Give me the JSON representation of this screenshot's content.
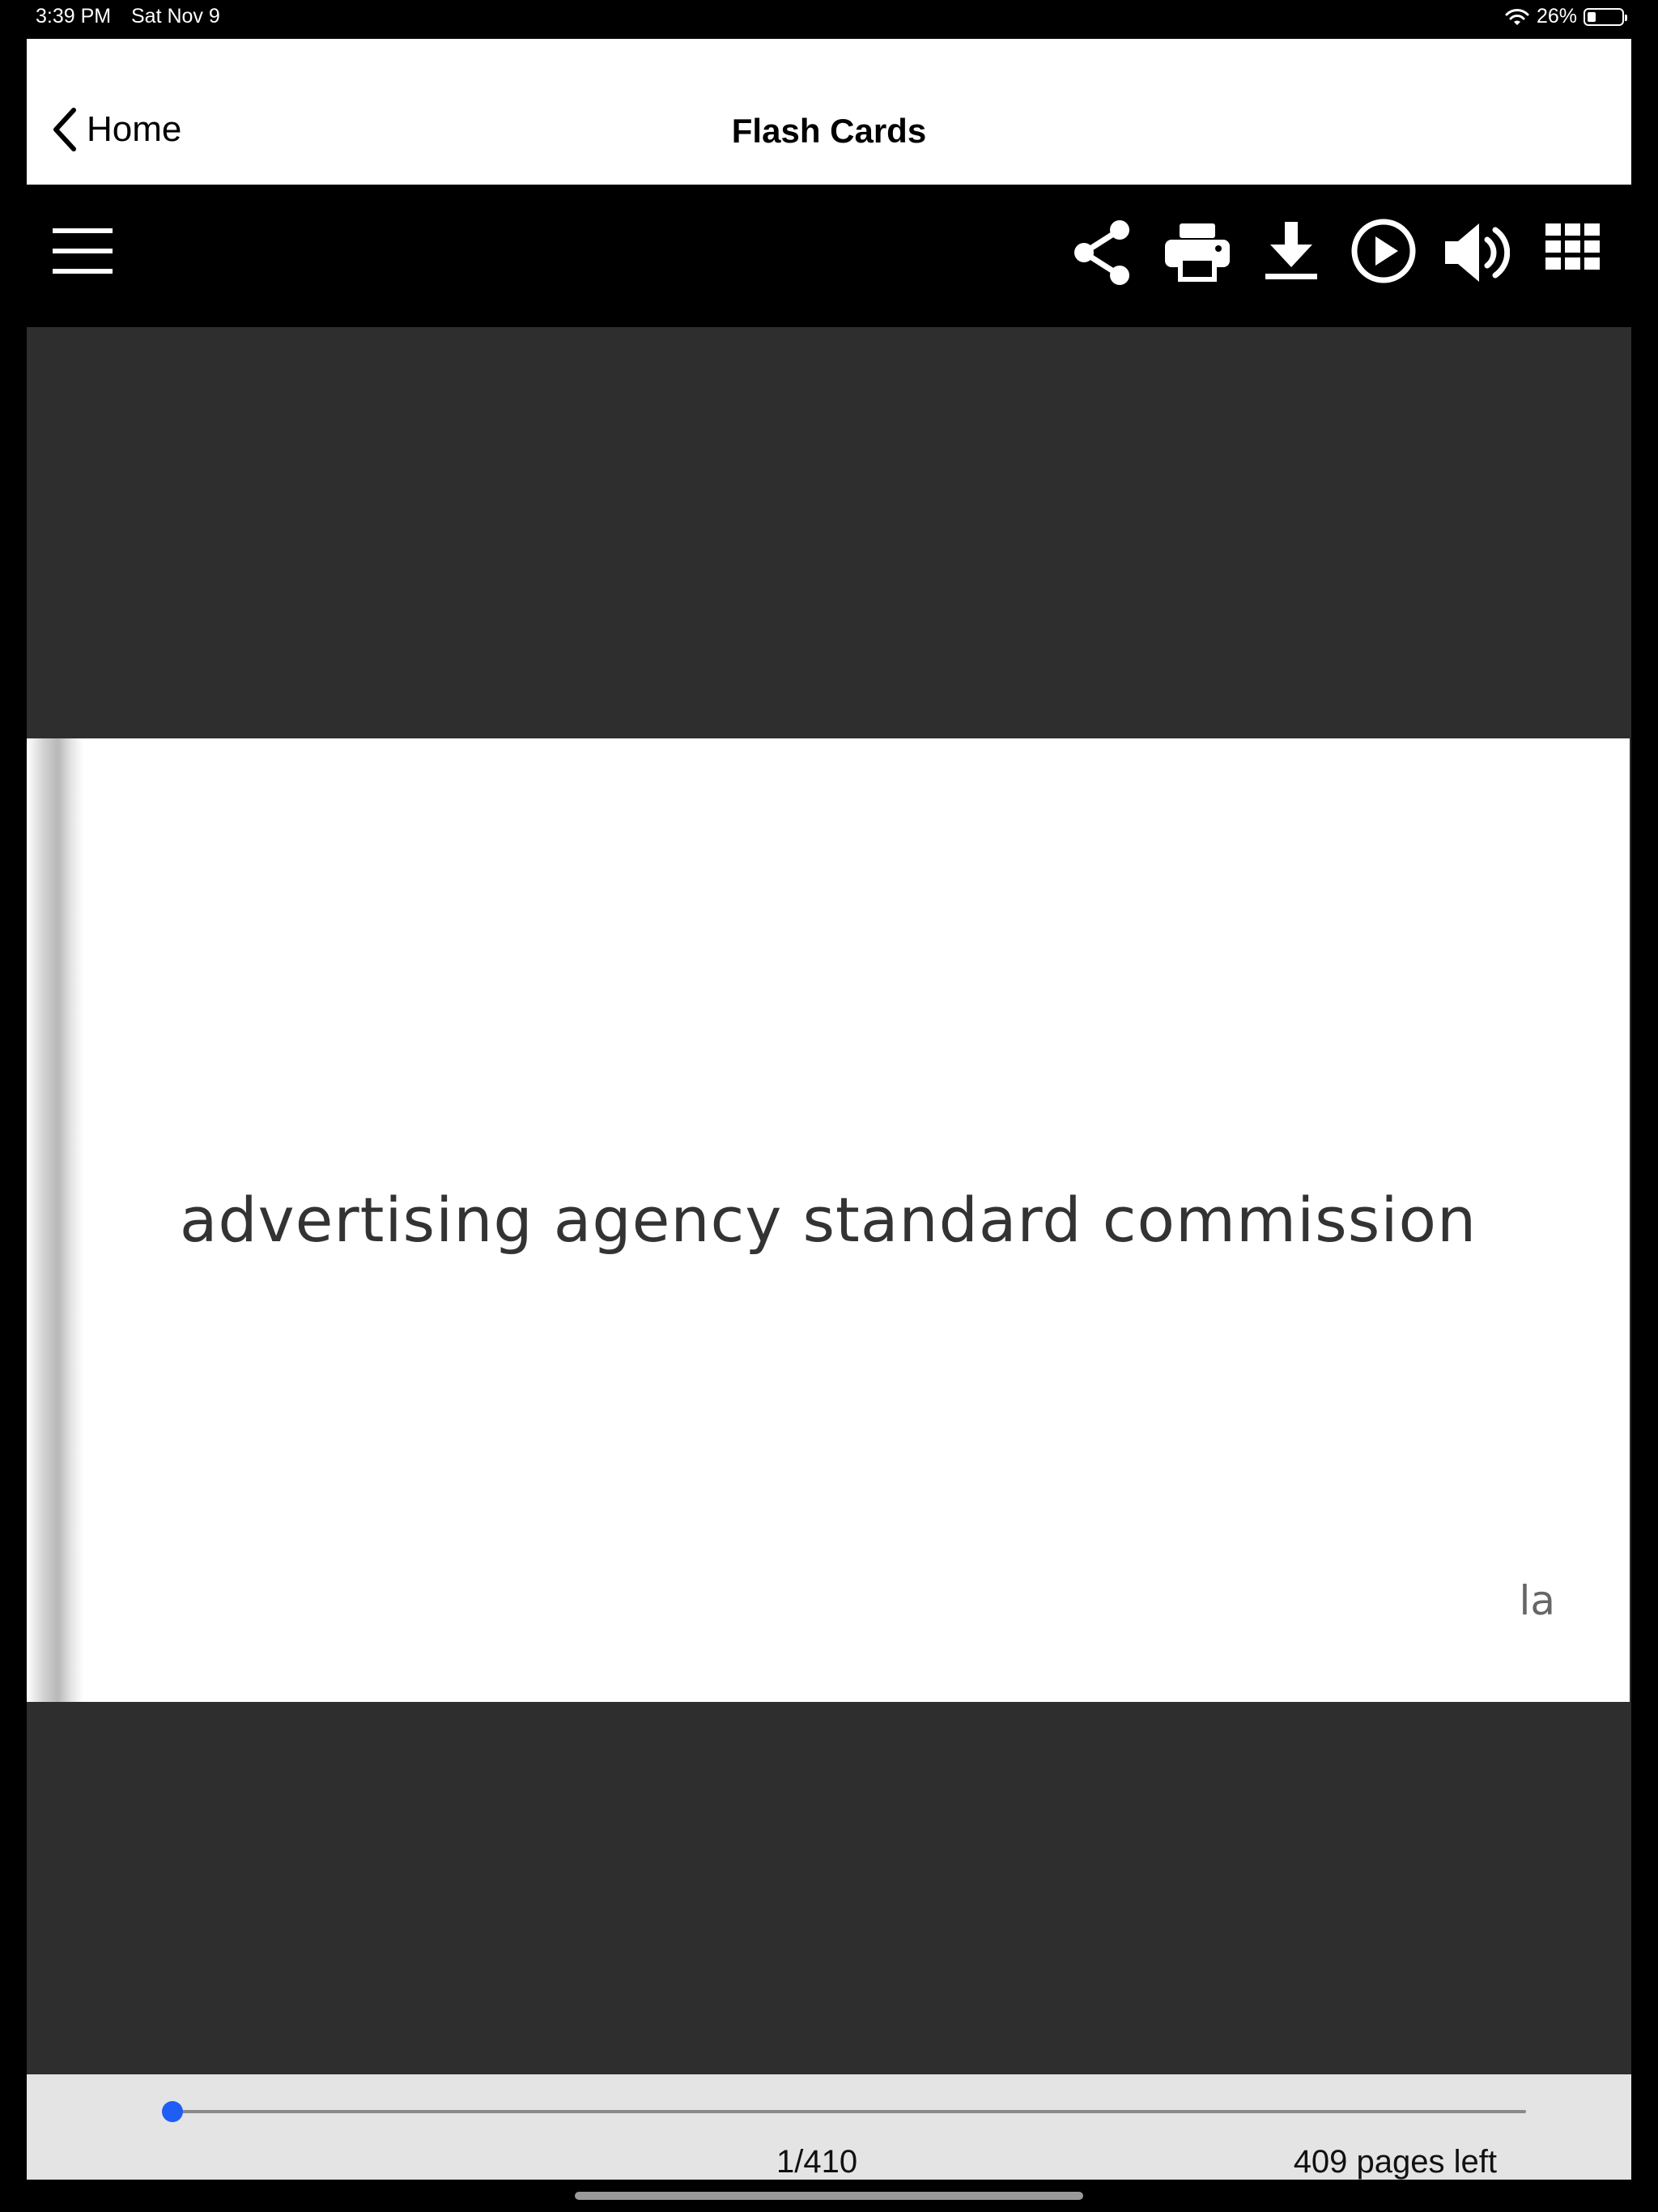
{
  "status_bar": {
    "time": "3:39 PM",
    "date": "Sat Nov 9",
    "battery_text": "26%",
    "battery_level": 0.26,
    "icons": [
      "wifi-icon",
      "battery-icon"
    ]
  },
  "nav": {
    "back_label": "Home",
    "title": "Flash Cards"
  },
  "toolbar": {
    "icons": [
      "menu-icon",
      "share-icon",
      "print-icon",
      "download-icon",
      "play-icon",
      "volume-icon",
      "grid-icon"
    ]
  },
  "card": {
    "term": "advertising agency standard commission",
    "corner_label": "la"
  },
  "pager": {
    "current_label": "1/410",
    "pages_left_label": "409 pages left",
    "progress": 0.0
  },
  "colors": {
    "background": "#000000",
    "viewer_background": "#2e2e2e",
    "slider_thumb": "#1e5ef5",
    "bottom_bar": "#e4e4e4"
  }
}
